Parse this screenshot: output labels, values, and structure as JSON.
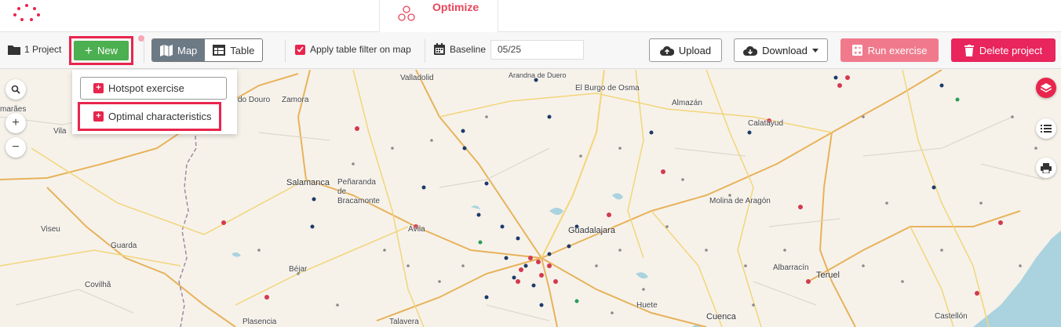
{
  "app": {
    "title": "Optimize"
  },
  "toolbar": {
    "project_count": "1 Project",
    "new_label": "New",
    "view_tabs": [
      {
        "label": "Map",
        "active": true
      },
      {
        "label": "Table",
        "active": false
      }
    ],
    "apply_filter_label": "Apply table filter on map",
    "apply_filter_checked": true,
    "baseline_label": "Baseline",
    "baseline_value": "05/25",
    "upload_label": "Upload",
    "download_label": "Download",
    "run_label": "Run exercise",
    "delete_label": "Delete project"
  },
  "new_menu": {
    "items": [
      {
        "label": "Hotspot exercise"
      },
      {
        "label": "Optimal characteristics"
      }
    ]
  },
  "map": {
    "places": [
      "Valladolid",
      "Arandna de Duero",
      "El Burgo de Osma",
      "Almazán",
      "Calatayud",
      "do Douro",
      "Zamora",
      "marães",
      "Vila",
      "Salamanca",
      "Peñaranda de Bracamonte",
      "Ávila",
      "Molina de Aragón",
      "Guadalajara",
      "Viseu",
      "Guarda",
      "Covilhã",
      "Béjar",
      "Albarracín",
      "Teruel",
      "Huete",
      "Cuenca",
      "Plasencia",
      "Talavera",
      "Castellón"
    ]
  },
  "colors": {
    "accent": "#e8254d",
    "new_button": "#4caf50",
    "run_button": "#f07a8c",
    "delete_button": "#e8255c",
    "active_tab": "#6c7a86"
  }
}
